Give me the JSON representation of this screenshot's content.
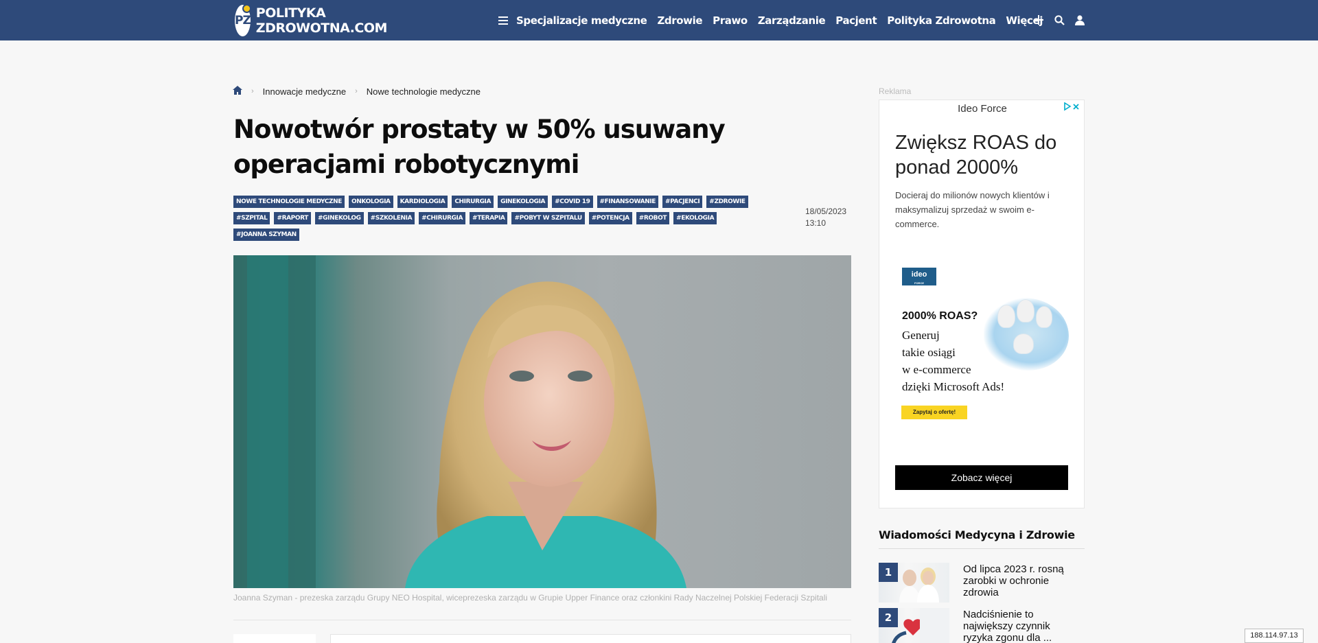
{
  "header": {
    "logo_mark": "PZ",
    "logo_line1": "POLITYKA",
    "logo_line2": "ZDROWOTNA.COM",
    "nav": [
      "Specjalizacje medyczne",
      "Zdrowie",
      "Prawo",
      "Zarządzanie",
      "Pacjent",
      "Polityka Zdrowotna",
      "Więcej"
    ],
    "icons": [
      "menu-icon",
      "plus-icon",
      "search-icon",
      "user-icon"
    ],
    "bg_color": "#2e4a7a"
  },
  "breadcrumb": {
    "home_icon": "home-icon",
    "items": [
      "Innowacje medyczne",
      "Nowe technologie medyczne"
    ]
  },
  "article": {
    "title": "Nowotwór prostaty w 50% usuwany operacjami robotycznymi",
    "tags": [
      "NOWE TECHNOLOGIE MEDYCZNE",
      "ONKOLOGIA",
      "KARDIOLOGIA",
      "CHIRURGIA",
      "GINEKOLOGIA",
      "#COVID 19",
      "#FINANSOWANIE",
      "#PACJENCI",
      "#ZDROWIE",
      "#SZPITAL",
      "#RAPORT",
      "#GINEKOLOG",
      "#SZKOLENIA",
      "#CHIRURGIA",
      "#TERAPIA",
      "#POBYT W SZPITALU",
      "#POTENCJA",
      "#ROBOT",
      "#EKOLOGIA",
      "#JOANNA SZYMAN"
    ],
    "date": "18/05/2023",
    "time": "13:10",
    "caption": "Joanna Szyman - prezeska zarządu Grupy NEO Hospital, wiceprezeska zarządu w Grupie Upper Finance oraz członkini Rady Naczelnej Polskiej Federacji Szpitali"
  },
  "sidebar": {
    "ad_label": "Reklama",
    "ad": {
      "brand": "Ideo Force",
      "headline": "Zwiększ ROAS do ponad 2000%",
      "body": "Docieraj do milionów nowych klientów i maksymalizuj sprzedaż w swoim e-commerce.",
      "logo_text": "ideo",
      "logo_sub": "FORCE",
      "creative_bold": "2000% ROAS?",
      "creative_text": [
        "Generuj",
        "takie osiągi",
        "w e-commerce",
        "dzięki Microsoft Ads!"
      ],
      "small_cta": "Zapytaj o ofertę!",
      "cta": "Zobacz więcej"
    },
    "news_title": "Wiadomości Medycyna i Zdrowie",
    "news": [
      {
        "num": "1",
        "text": "Od lipca 2023 r. rosną zarobki w ochronie zdrowia"
      },
      {
        "num": "2",
        "text": "Nadciśnienie to największy czynnik ryzyka zgonu dla ..."
      }
    ]
  },
  "ip": "188.114.97.13"
}
